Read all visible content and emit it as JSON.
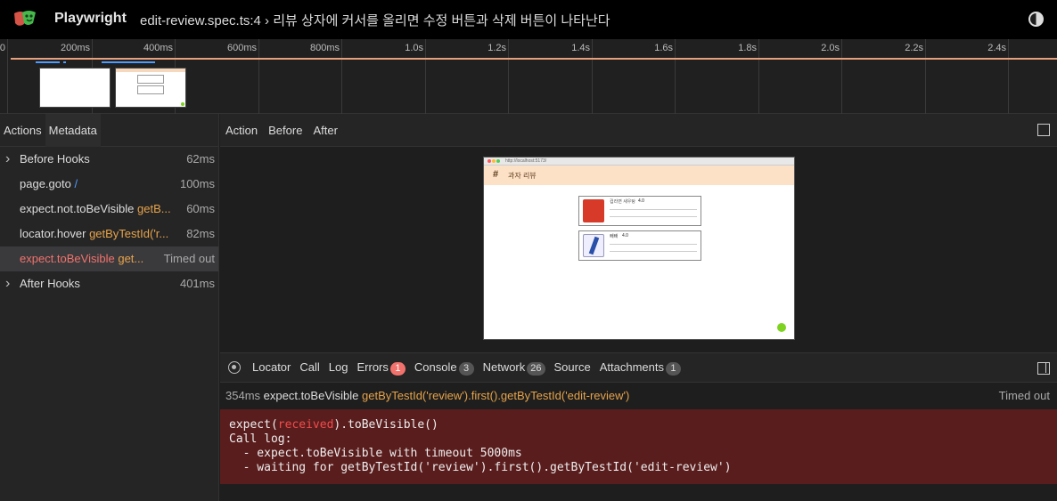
{
  "header": {
    "app_name": "Playwright",
    "title": "edit-review.spec.ts:4 › 리뷰 상자에 커서를 올리면 수정 버튼과 삭제 버튼이 나타난다"
  },
  "timeline": {
    "ticks": [
      "0",
      "200ms",
      "400ms",
      "600ms",
      "800ms",
      "1.0s",
      "1.2s",
      "1.4s",
      "1.6s",
      "1.8s",
      "2.0s",
      "2.2s",
      "2.4s"
    ]
  },
  "sidebar": {
    "tabs": [
      "Actions",
      "Metadata"
    ],
    "actions": [
      {
        "name": "Before Hooks",
        "selector": "",
        "duration": "62ms",
        "expandable": true
      },
      {
        "name": "page.goto",
        "selector": "/",
        "duration": "100ms",
        "expandable": false
      },
      {
        "name": "expect.not.toBeVisible",
        "selector": "getB...",
        "duration": "60ms",
        "expandable": false
      },
      {
        "name": "locator.hover",
        "selector": "getByTestId('r...",
        "duration": "82ms",
        "expandable": false
      },
      {
        "name": "expect.toBeVisible",
        "selector": "get...",
        "duration": "Timed out",
        "expandable": false,
        "selected": true
      },
      {
        "name": "After Hooks",
        "selector": "",
        "duration": "401ms",
        "expandable": true
      }
    ]
  },
  "main": {
    "tabs": [
      "Action",
      "Before",
      "After"
    ],
    "preview": {
      "url": "http://localhost:5173/",
      "site_title": "과자 리뷰",
      "items": [
        {
          "name": "컵라면 새우탕",
          "rating": "4.0"
        },
        {
          "name": "빼빼",
          "rating": "4.0"
        }
      ]
    }
  },
  "bottom_tabs": [
    {
      "label": "Locator",
      "count": ""
    },
    {
      "label": "Call",
      "count": ""
    },
    {
      "label": "Log",
      "count": ""
    },
    {
      "label": "Errors",
      "count": "1"
    },
    {
      "label": "Console",
      "count": "3"
    },
    {
      "label": "Network",
      "count": "26"
    },
    {
      "label": "Source",
      "count": ""
    },
    {
      "label": "Attachments",
      "count": "1"
    }
  ],
  "error": {
    "time": "354ms",
    "action": "expect.toBeVisible",
    "selector": "getByTestId('review').first().getByTestId('edit-review')",
    "status": "Timed out",
    "line1_pre": "expect(",
    "line1_recv": "received",
    "line1_post": ").toBeVisible()",
    "line2": "Call log:",
    "line3": "  - expect.toBeVisible with timeout 5000ms",
    "line4": "  - waiting for getByTestId('review').first().getByTestId('edit-review')"
  },
  "colors": {
    "accent_orange": "#e6a34a",
    "error_red": "#f1726c",
    "link_blue": "#4d9bff",
    "error_bg": "#5a1d1d"
  }
}
